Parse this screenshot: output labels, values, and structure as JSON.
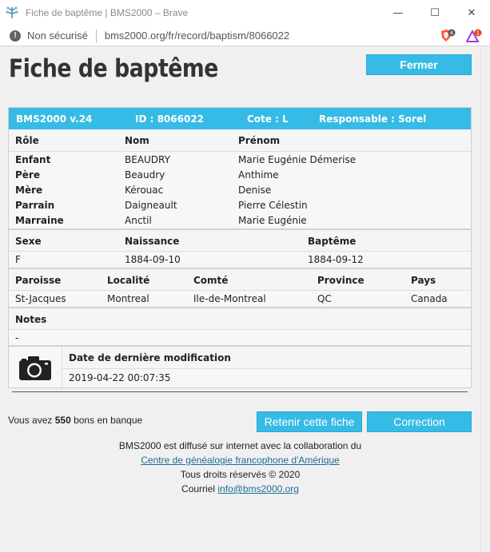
{
  "window": {
    "title": "Fiche de baptême | BMS2000 – Brave",
    "minimize": "—",
    "maximize": "☐",
    "close": "✕"
  },
  "address": {
    "security": "Non sécurisé",
    "url": "bms2000.org/fr/record/baptism/8066022",
    "shield_count": "4",
    "rewards_count": "1"
  },
  "page": {
    "title": "Fiche de baptême",
    "close_label": "Fermer"
  },
  "record": {
    "version": "BMS2000 v.24",
    "id": "ID : 8066022",
    "cote": "Cote : L",
    "responsible": "Responsable : Sorel",
    "persons_headers": [
      "Rôle",
      "Nom",
      "Prénom"
    ],
    "persons": [
      {
        "role": "Enfant",
        "nom": "BEAUDRY",
        "prenom": "Marie Eugénie Démerise"
      },
      {
        "role": "Père",
        "nom": "Beaudry",
        "prenom": "Anthime"
      },
      {
        "role": "Mère",
        "nom": "Kérouac",
        "prenom": "Denise"
      },
      {
        "role": "Parrain",
        "nom": "Daigneault",
        "prenom": "Pierre Célestin"
      },
      {
        "role": "Marraine",
        "nom": "Anctil",
        "prenom": "Marie Eugénie"
      }
    ],
    "event_headers": [
      "Sexe",
      "Naissance",
      "Baptême"
    ],
    "event": {
      "sexe": "F",
      "naissance": "1884-09-10",
      "bapteme": "1884-09-12"
    },
    "place_headers": [
      "Paroisse",
      "Localité",
      "Comté",
      "Province",
      "Pays"
    ],
    "place": {
      "paroisse": "St-Jacques",
      "localite": "Montreal",
      "comte": "Ile-de-Montreal",
      "province": "QC",
      "pays": "Canada"
    },
    "notes_header": "Notes",
    "notes": "-",
    "modified_header": "Date de dernière modification",
    "modified": "2019-04-22 00:07:35"
  },
  "bank": {
    "prefix": "Vous avez ",
    "count": "550",
    "suffix": " bons en banque"
  },
  "actions": {
    "keep_label": "Retenir cette fiche",
    "correction_label": "Correction"
  },
  "footer": {
    "line1": "BMS2000 est diffusé sur internet avec la collaboration du",
    "link_text": "Centre de généalogie francophone d'Amérique",
    "rights": "Tous droits réservés © 2020",
    "email_prefix": "Courriel ",
    "email": "info@bms2000.org"
  },
  "colors": {
    "accent": "#35bbe5",
    "link": "#1a6f95"
  }
}
